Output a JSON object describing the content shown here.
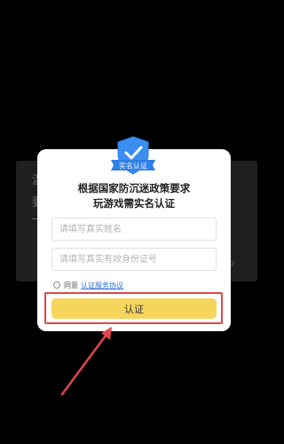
{
  "background": {
    "line1": "温",
    "line2": "要",
    "right_hint": "o"
  },
  "dialog": {
    "badge_label": "实名认证",
    "heading_line1": "根据国家防沉迷政策要求",
    "heading_line2": "玩游戏需实名认证",
    "name_placeholder": "请填写真实姓名",
    "id_placeholder": "请填写真实有效身份证号",
    "agree_prefix": "同意",
    "agree_link": "认证服务协议",
    "submit_label": "认证"
  },
  "colors": {
    "submit": "#f5d55c",
    "highlight": "#e0474c",
    "badge": "#2f7fe6"
  }
}
